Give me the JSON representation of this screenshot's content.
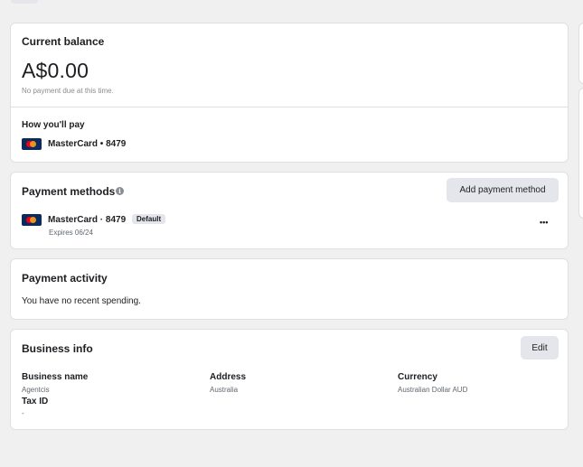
{
  "balance": {
    "title": "Current balance",
    "amount": "A$0.00",
    "note": "No payment due at this time.",
    "how_title": "How you'll pay",
    "card_label": "MasterCard • 8479"
  },
  "payment_methods": {
    "title": "Payment methods",
    "info_icon": "i",
    "add_button": "Add payment method",
    "card_label": "MasterCard · 8479",
    "default_badge": "Default",
    "expires": "Expires 06/24",
    "more_icon": "•••"
  },
  "activity": {
    "title": "Payment activity",
    "message": "You have no recent spending."
  },
  "business": {
    "title": "Business info",
    "edit_button": "Edit",
    "fields": {
      "name_label": "Business name",
      "name_value": "Agentcis",
      "address_label": "Address",
      "address_value": "Australia",
      "currency_label": "Currency",
      "currency_value": "Australian Dollar AUD",
      "taxid_label": "Tax ID",
      "taxid_value": "-"
    }
  },
  "colors": {
    "page_bg": "#f0f0f0",
    "card_bg": "#ffffff",
    "button_bg": "#e4e6eb",
    "mastercard_navy": "#0c2a5b",
    "mastercard_red": "#eb001b",
    "mastercard_orange": "#f79e1b"
  }
}
